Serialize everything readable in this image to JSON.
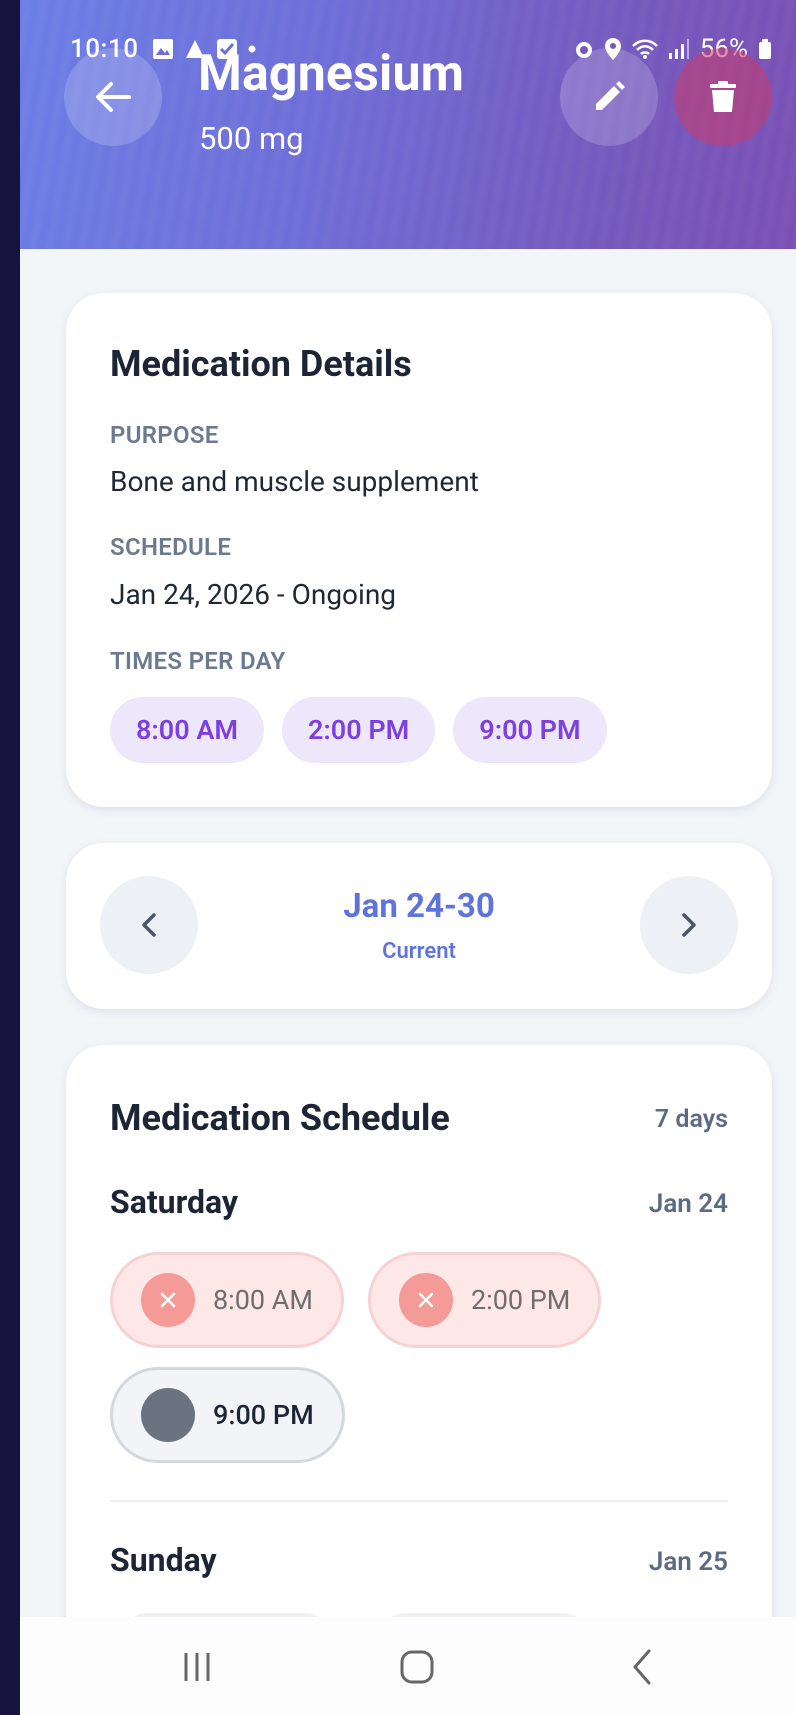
{
  "status_bar": {
    "time": "10:10",
    "battery": "56%"
  },
  "header": {
    "title": "Magnesium",
    "subtitle": "500 mg",
    "back_icon": "arrow-left-icon",
    "edit_icon": "pencil-icon",
    "delete_icon": "trash-icon"
  },
  "details": {
    "title": "Medication Details",
    "purpose_label": "PURPOSE",
    "purpose_value": "Bone and muscle supplement",
    "schedule_label": "SCHEDULE",
    "schedule_value": "Jan 24, 2026 - Ongoing",
    "times_label": "TIMES PER DAY",
    "times": [
      "8:00 AM",
      "2:00 PM",
      "9:00 PM"
    ]
  },
  "week_nav": {
    "range": "Jan 24-30",
    "sub": "Current"
  },
  "schedule": {
    "title": "Medication Schedule",
    "count": "7 days",
    "days": [
      {
        "name": "Saturday",
        "date": "Jan 24",
        "doses": [
          {
            "time": "8:00 AM",
            "status": "missed"
          },
          {
            "time": "2:00 PM",
            "status": "missed"
          },
          {
            "time": "9:00 PM",
            "status": "pending"
          }
        ]
      },
      {
        "name": "Sunday",
        "date": "Jan 25",
        "doses": []
      }
    ]
  },
  "colors": {
    "accent": "#7d3fe0",
    "week_accent": "#5f73df",
    "missed": "#f49a97",
    "pending": "#6a7380"
  }
}
